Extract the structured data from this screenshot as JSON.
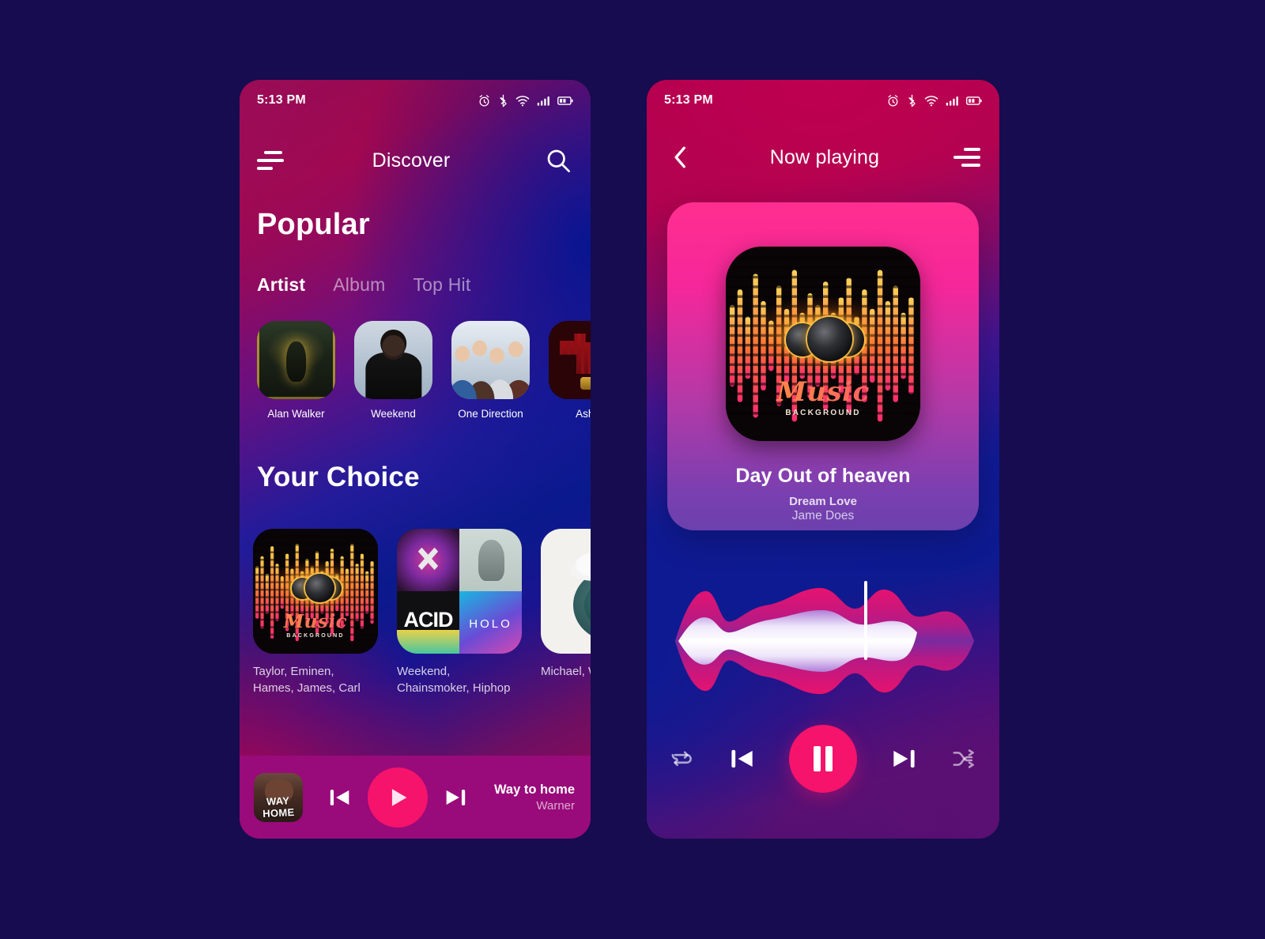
{
  "theme": {
    "page_bg": "#160c4f",
    "accent_pink": "#f5136b",
    "mini_bar_bg": "#990a7a",
    "deep_blue": "#0a1a8c",
    "crimson": "#a50550"
  },
  "discover": {
    "status": {
      "time": "5:13 PM",
      "icons": [
        "alarm-icon",
        "bluetooth-icon",
        "wifi-icon",
        "signal-icon",
        "battery-icon"
      ]
    },
    "appbar": {
      "menu_icon": "hamburger-icon",
      "title": "Discover",
      "search_icon": "search-icon"
    },
    "popular": {
      "title": "Popular",
      "tabs": [
        {
          "label": "Artist",
          "active": true
        },
        {
          "label": "Album",
          "active": false
        },
        {
          "label": "Top Hit",
          "active": false
        }
      ],
      "artists": [
        {
          "name": "Alan Walker",
          "art": "art-alanwalker"
        },
        {
          "name": "Weekend",
          "art": "art-weekend"
        },
        {
          "name": "One Direction",
          "art": "art-onedirection"
        },
        {
          "name": "Ashe",
          "art": "art-ashes"
        }
      ]
    },
    "your_choice": {
      "title": "Your Choice",
      "items": [
        {
          "name": "Taylor, Eminen, Hames, James, Carl",
          "art": "art-music"
        },
        {
          "name": "Weekend, Chainsmoker, Hiphop",
          "art": "art-acid"
        },
        {
          "name": "Michael, W Loverband",
          "art": "art-michael"
        }
      ]
    },
    "mini_player": {
      "thumb_label": "WAY HOME",
      "title": "Way to home",
      "artist": "Warner",
      "prev_icon": "previous-icon",
      "play_icon": "play-icon",
      "next_icon": "next-icon"
    }
  },
  "player": {
    "status": {
      "time": "5:13 PM",
      "icons": [
        "alarm-icon",
        "bluetooth-icon",
        "wifi-icon",
        "signal-icon",
        "battery-icon"
      ]
    },
    "appbar": {
      "back_icon": "back-chevron-icon",
      "title": "Now playing",
      "menu_icon": "hamburger-icon"
    },
    "song": {
      "title": "Day Out of heaven",
      "album": "Dream Love",
      "artist": "Jame Does",
      "album_art_words": {
        "main": "Music",
        "sub": "BACKGROUND"
      }
    },
    "controls": {
      "repeat_icon": "repeat-icon",
      "prev_icon": "previous-icon",
      "play_pause_icon": "pause-icon",
      "next_icon": "next-icon",
      "shuffle_icon": "shuffle-icon"
    }
  }
}
